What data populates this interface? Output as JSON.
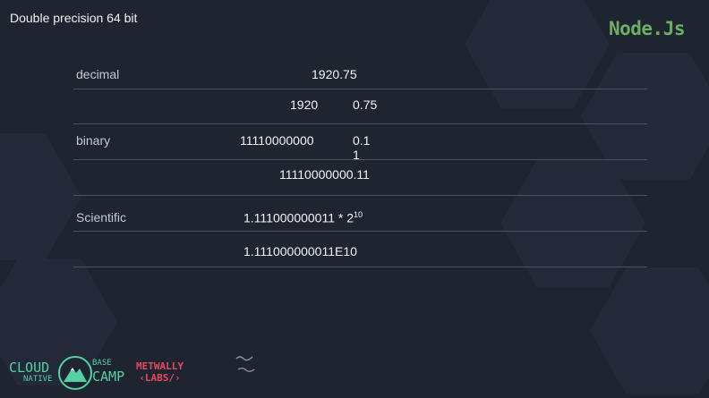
{
  "slide": {
    "title": "Double precision 64 bit",
    "brand": "Node.Js"
  },
  "table": {
    "rows": [
      {
        "label": "decimal",
        "value": "1920.75"
      },
      {
        "label": "",
        "int_part": "1920",
        "frac_part": "0.75"
      },
      {
        "label": "binary",
        "int_part": "11110000000",
        "frac_part_line1": "0.1",
        "frac_part_line2": "1"
      },
      {
        "label": "",
        "value": "11110000000.11"
      },
      {
        "label": "Scientific",
        "mantissa": "1.111000000011 * 2",
        "exponent": "10"
      },
      {
        "label": "",
        "value": "1.111000000011E10"
      }
    ]
  },
  "logos": {
    "cloud_big": "CLOUD",
    "cloud_small": "NATIVE",
    "camp_small": "BASE",
    "camp_big": "CAMP",
    "metwally_line1": "METWALLY",
    "metwally_line2": "‹LABS/›"
  },
  "colors": {
    "background": "#1f2431",
    "brand": "#6cae63",
    "divider": "#4b5160",
    "cloud_accent": "#55d0a4",
    "metwally": "#e64a5d"
  }
}
